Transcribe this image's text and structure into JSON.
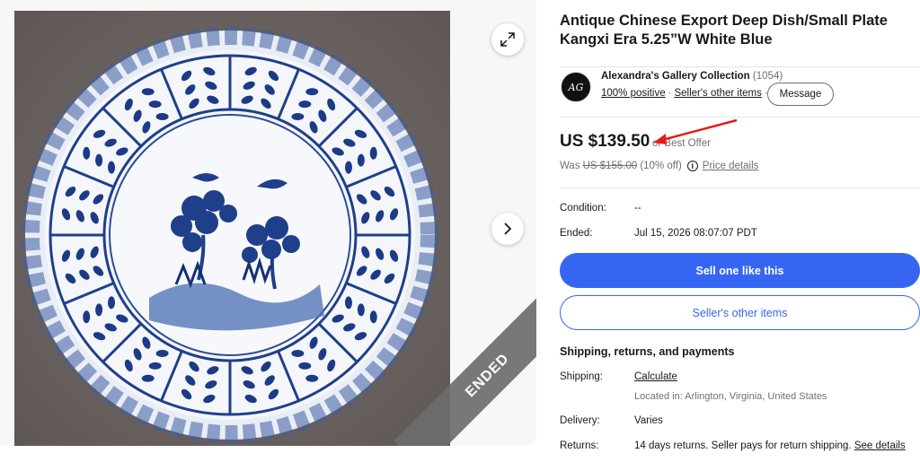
{
  "gallery": {
    "ribbon_text": "ENDED",
    "expand_icon": "expand-icon",
    "next_icon": "chevron-right-icon"
  },
  "listing": {
    "title_line1": "Antique Chinese Export Deep Dish/Small Plate",
    "title_line2": "Kangxi Era 5.25”W White Blue"
  },
  "seller": {
    "avatar_text": "AG",
    "name": "Alexandra's Gallery Collection",
    "count": "(1054)",
    "positive": "100% positive",
    "other_items_link": "Seller's other items",
    "message_button": "Message"
  },
  "price": {
    "current": "US $139.50",
    "best_offer": "or Best Offer",
    "was_label": "Was",
    "was_value": "US $155.00",
    "discount": "(10% off)",
    "details_link": "Price details",
    "annotation_arrow_color": "#e31b1b"
  },
  "details": {
    "condition_label": "Condition:",
    "condition_value": "--",
    "ended_label": "Ended:",
    "ended_value": "Jul 15, 2026 08:07:07 PDT"
  },
  "actions": {
    "sell_button": "Sell one like this",
    "other_items_button": "Seller's other items",
    "primary_color": "#3665f3"
  },
  "shipping": {
    "heading": "Shipping, returns, and payments",
    "shipping_label": "Shipping:",
    "shipping_value": "Calculate",
    "location": "Located in: Arlington, Virginia, United States",
    "delivery_label": "Delivery:",
    "delivery_value": "Varies",
    "returns_label": "Returns:",
    "returns_value": "14 days returns. Seller pays for return shipping.",
    "returns_link": "See details"
  }
}
